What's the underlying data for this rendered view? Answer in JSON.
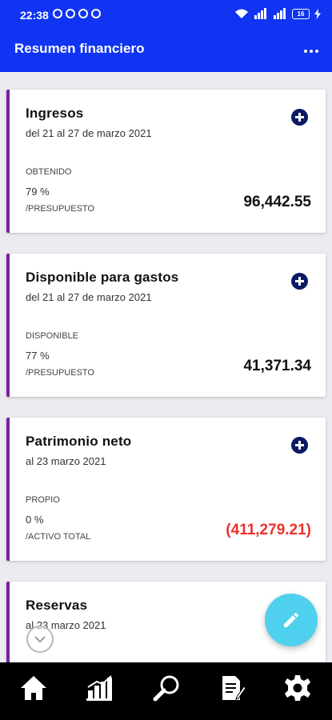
{
  "status_bar": {
    "time": "22:38",
    "battery": "16"
  },
  "header": {
    "title": "Resumen financiero"
  },
  "cards": [
    {
      "title": "Ingresos",
      "date": "del 21 al 27 de marzo 2021",
      "status_label": "OBTENIDO",
      "percent": "79 %",
      "reference": "/PRESUPUESTO",
      "amount": "96,442.55"
    },
    {
      "title": "Disponible para gastos",
      "date": "del 21 al 27 de marzo 2021",
      "status_label": "DISPONIBLE",
      "percent": "77 %",
      "reference": "/PRESUPUESTO",
      "amount": "41,371.34"
    },
    {
      "title": "Patrimonio neto",
      "date": "al 23 marzo 2021",
      "status_label": "PROPIO",
      "percent": "0 %",
      "reference": "/ACTIVO TOTAL",
      "amount": "(411,279.21)"
    },
    {
      "title": "Reservas",
      "date": "al 23 marzo 2021"
    }
  ],
  "colors": {
    "primary": "#1034f2",
    "card_accent": "#7b1fa2",
    "negative": "#e8322d",
    "fab": "#4fd0ef",
    "add_icon": "#0b1a64"
  },
  "icons": {
    "more": "more-vert-icon",
    "add": "add-circle-icon",
    "fab": "edit-pencil-icon",
    "nav": [
      "home-icon",
      "bar-chart-icon",
      "search-icon",
      "report-edit-icon",
      "settings-gear-icon"
    ]
  }
}
